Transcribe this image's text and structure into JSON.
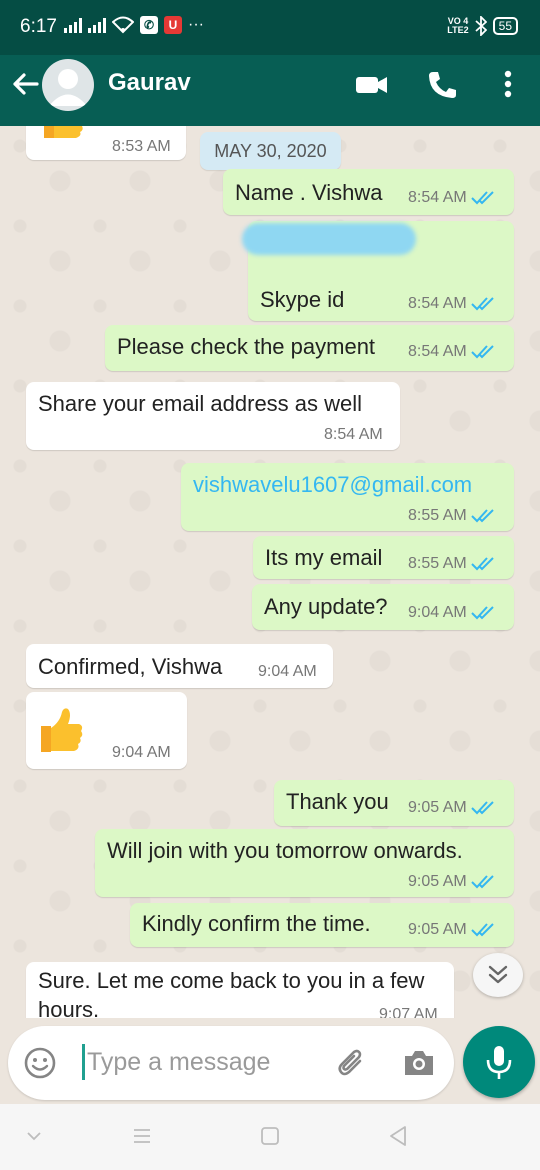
{
  "status_bar": {
    "time": "6:17",
    "more": "···",
    "volte_top": "VO 4",
    "volte_bottom": "LTE2",
    "battery": "55",
    "app_badge_u": "U"
  },
  "header": {
    "contact_name": "Gaurav"
  },
  "chat": {
    "date_chip": "MAY 30, 2020",
    "messages": [
      {
        "direction": "in",
        "text": "",
        "emoji": "thumbs-up",
        "time": "8:53 AM"
      },
      {
        "direction": "out",
        "text": "Name . Vishwa",
        "time": "8:54 AM",
        "status": "read"
      },
      {
        "direction": "out",
        "text": "Skype id",
        "time": "8:54 AM",
        "status": "read"
      },
      {
        "direction": "out",
        "text": "Please check the payment",
        "time": "8:54 AM",
        "status": "read"
      },
      {
        "direction": "in",
        "text": "Share your email address as well",
        "time": "8:54 AM"
      },
      {
        "direction": "out",
        "text": "vishwavelu1607@gmail.com",
        "time": "8:55 AM",
        "status": "read"
      },
      {
        "direction": "out",
        "text": "Its my email",
        "time": "8:55 AM",
        "status": "read"
      },
      {
        "direction": "out",
        "text": "Any update?",
        "time": "9:04 AM",
        "status": "read"
      },
      {
        "direction": "in",
        "text": "Confirmed, Vishwa",
        "time": "9:04 AM"
      },
      {
        "direction": "in",
        "text": "",
        "emoji": "thumbs-up",
        "time": "9:04 AM"
      },
      {
        "direction": "out",
        "text": "Thank you",
        "time": "9:05 AM",
        "status": "read"
      },
      {
        "direction": "out",
        "text": "Will join with you tomorrow onwards.",
        "time": "9:05 AM",
        "status": "read"
      },
      {
        "direction": "out",
        "text": "Kindly confirm the time.",
        "time": "9:05 AM",
        "status": "read"
      },
      {
        "direction": "in",
        "text": "Sure. Let me come back to you in a few hours.",
        "time": "9:07 AM"
      }
    ]
  },
  "composer": {
    "placeholder": "Type a message",
    "value": ""
  },
  "colors": {
    "header": "#075e54",
    "status_bar": "#054d44",
    "outgoing_bubble": "#dcf8c6",
    "incoming_bubble": "#ffffff",
    "read_ticks": "#34b7f1",
    "mic_button": "#00897b",
    "date_chip": "#d5eaf4"
  },
  "icons": [
    "back-arrow-icon",
    "avatar-icon",
    "video-call-icon",
    "phone-icon",
    "more-vert-icon",
    "emoji-icon",
    "attach-icon",
    "camera-icon",
    "mic-icon",
    "scroll-down-icon",
    "double-check-icon",
    "thumbs-up-emoji"
  ]
}
